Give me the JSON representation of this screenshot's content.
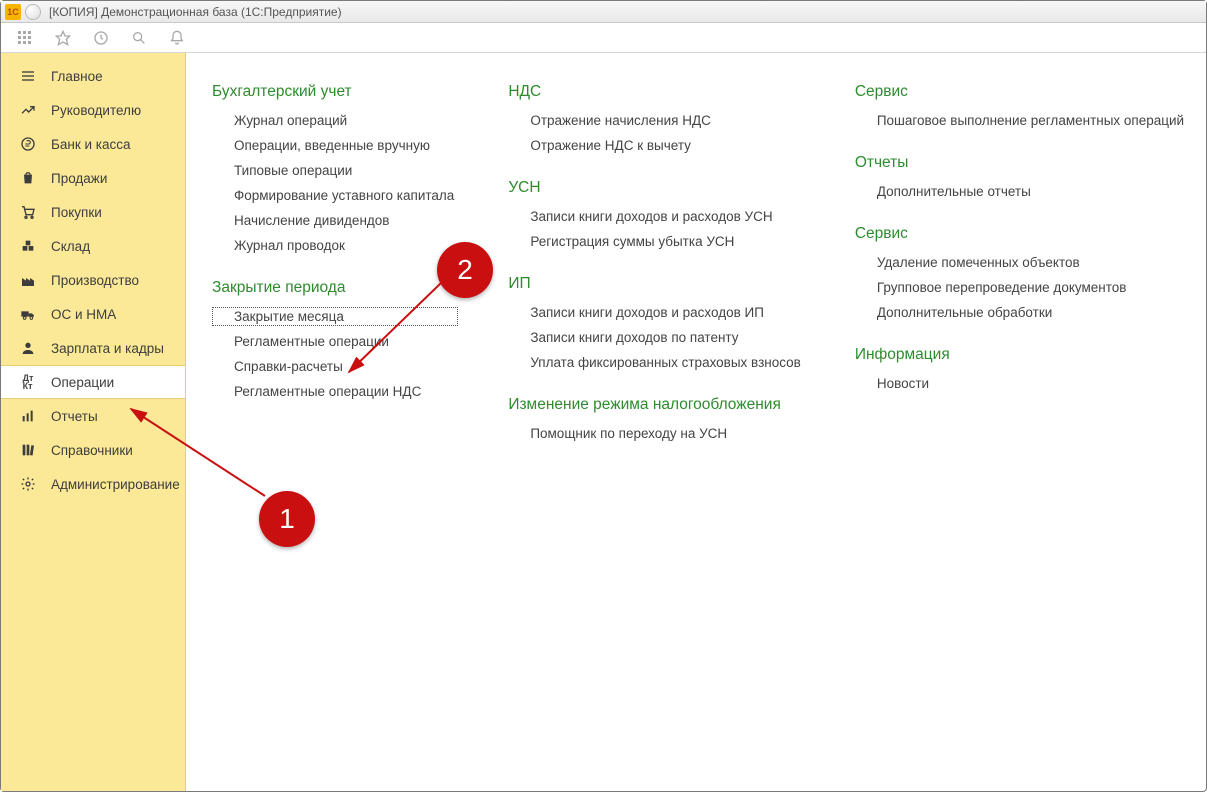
{
  "titlebar": {
    "app_icon_text": "1C",
    "title": "[КОПИЯ] Демонстрационная база  (1С:Предприятие)"
  },
  "sidebar": {
    "items": [
      {
        "label": "Главное",
        "icon": "menu"
      },
      {
        "label": "Руководителю",
        "icon": "trend"
      },
      {
        "label": "Банк и касса",
        "icon": "ruble"
      },
      {
        "label": "Продажи",
        "icon": "bag"
      },
      {
        "label": "Покупки",
        "icon": "cart"
      },
      {
        "label": "Склад",
        "icon": "boxes"
      },
      {
        "label": "Производство",
        "icon": "factory"
      },
      {
        "label": "ОС и НМА",
        "icon": "truck"
      },
      {
        "label": "Зарплата и кадры",
        "icon": "person"
      },
      {
        "label": "Операции",
        "icon": "dtkt",
        "active": true
      },
      {
        "label": "Отчеты",
        "icon": "chart"
      },
      {
        "label": "Справочники",
        "icon": "books"
      },
      {
        "label": "Администрирование",
        "icon": "gear"
      }
    ]
  },
  "content": {
    "col1": [
      {
        "title": "Бухгалтерский учет",
        "links": [
          "Журнал операций",
          "Операции, введенные вручную",
          "Типовые операции",
          "Формирование уставного капитала",
          "Начисление дивидендов",
          "Журнал проводок"
        ]
      },
      {
        "title": "Закрытие периода",
        "links": [
          "Закрытие месяца",
          "Регламентные операции",
          "Справки-расчеты",
          "Регламентные операции НДС"
        ]
      }
    ],
    "col2": [
      {
        "title": "НДС",
        "links": [
          "Отражение начисления НДС",
          "Отражение НДС к вычету"
        ]
      },
      {
        "title": "УСН",
        "links": [
          "Записи книги доходов и расходов УСН",
          "Регистрация суммы убытка УСН"
        ]
      },
      {
        "title": "ИП",
        "links": [
          "Записи книги доходов и расходов ИП",
          "Записи книги доходов по патенту",
          "Уплата фиксированных страховых взносов"
        ]
      },
      {
        "title": "Изменение режима налогообложения",
        "links": [
          "Помощник по переходу на УСН"
        ]
      }
    ],
    "col3": [
      {
        "title": "Сервис",
        "links": [
          "Пошаговое выполнение регламентных операций"
        ]
      },
      {
        "title": "Отчеты",
        "links": [
          "Дополнительные отчеты"
        ]
      },
      {
        "title": "Сервис",
        "links": [
          "Удаление помеченных объектов",
          "Групповое перепроведение документов",
          "Дополнительные обработки"
        ]
      },
      {
        "title": "Информация",
        "links": [
          "Новости"
        ]
      }
    ]
  },
  "annotations": {
    "badge1": "1",
    "badge2": "2"
  },
  "focused_link": "Закрытие месяца"
}
